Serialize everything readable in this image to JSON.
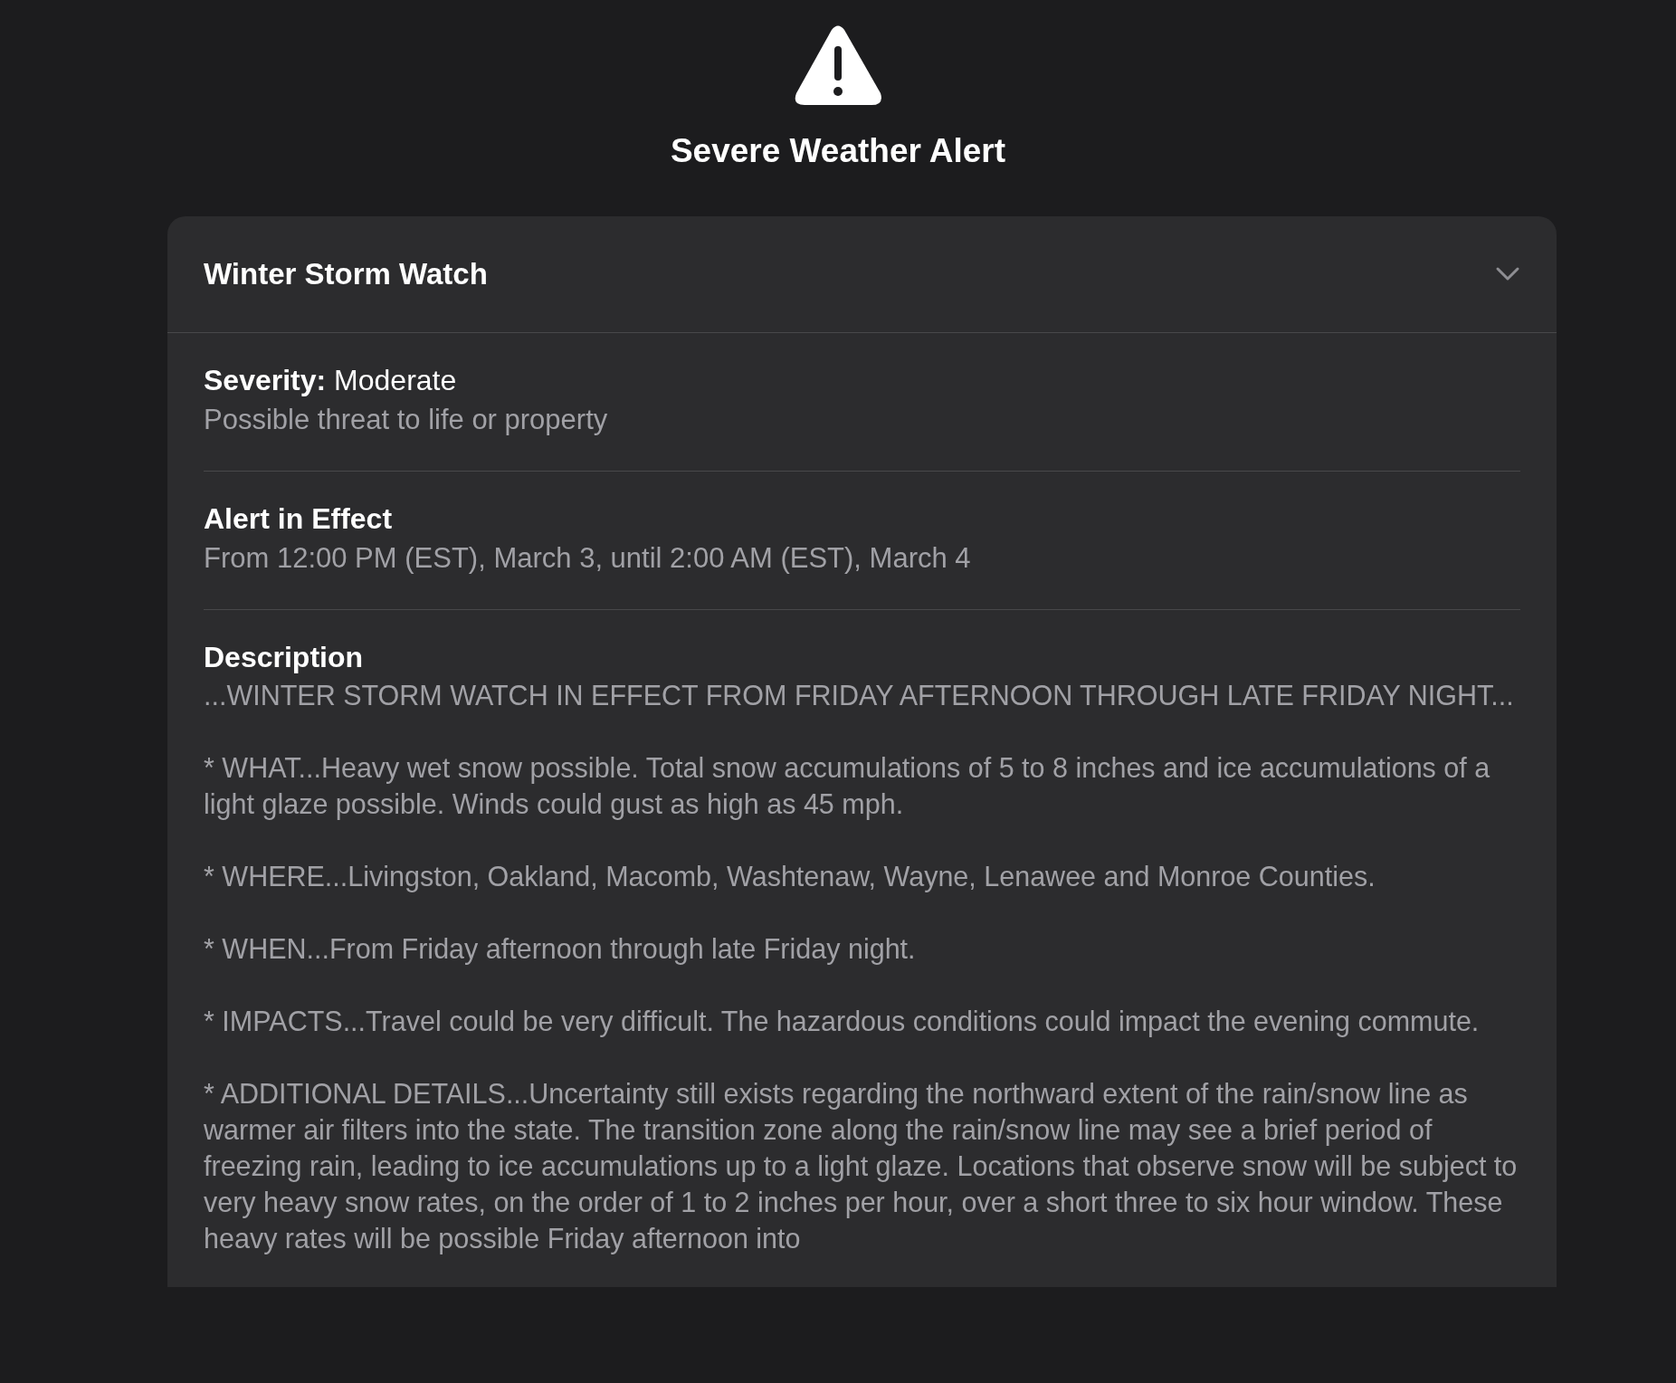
{
  "title": "Severe Weather Alert",
  "alert": {
    "name": "Winter Storm Watch",
    "expanded": true,
    "severity": {
      "label": "Severity:",
      "value": "Moderate",
      "note": "Possible threat to life or property"
    },
    "effect": {
      "label": "Alert in Effect",
      "text": "From 12:00 PM (EST), March 3, until 2:00 AM (EST), March 4"
    },
    "description": {
      "label": "Description",
      "paragraphs": [
        "...WINTER STORM WATCH IN EFFECT FROM FRIDAY AFTERNOON THROUGH LATE FRIDAY NIGHT...",
        "* WHAT...Heavy wet snow possible. Total snow accumulations of 5 to 8 inches and ice accumulations of a light glaze possible. Winds could gust as high as 45 mph.",
        "* WHERE...Livingston, Oakland, Macomb, Washtenaw, Wayne, Lenawee and Monroe Counties.",
        "* WHEN...From Friday afternoon through late Friday night.",
        "* IMPACTS...Travel could be very difficult. The hazardous conditions could impact the evening commute.",
        "* ADDITIONAL DETAILS...Uncertainty still exists regarding the northward extent of the rain/snow line as warmer air filters into the state. The transition zone along the rain/snow line may see a brief period of freezing rain, leading to ice accumulations up to a light glaze. Locations that observe snow will be subject to very heavy snow rates, on the order of 1 to 2 inches per hour, over a short three to six hour window. These heavy rates will be possible Friday afternoon into"
      ]
    }
  }
}
